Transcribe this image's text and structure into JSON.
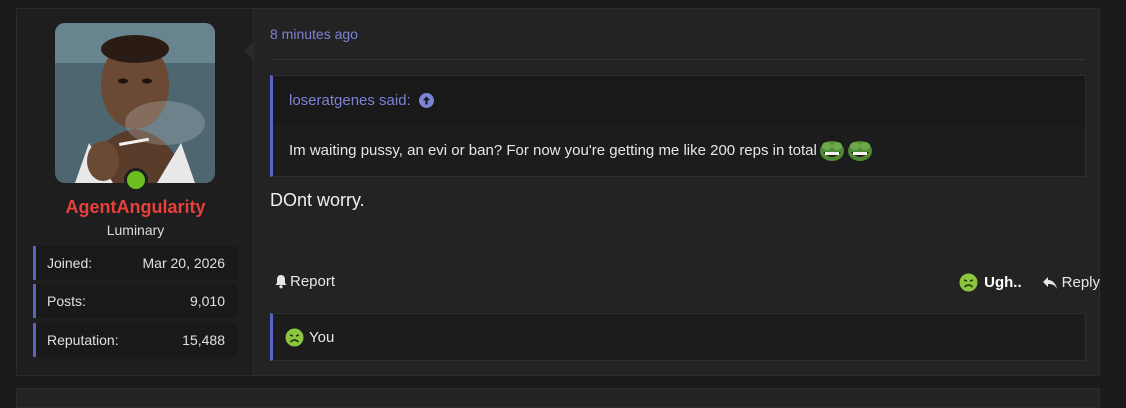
{
  "user": {
    "username": "AgentAngularity",
    "title": "Luminary",
    "online": true,
    "stats": [
      {
        "label": "Joined:",
        "value": "Mar 20, 2026"
      },
      {
        "label": "Posts:",
        "value": "9,010"
      },
      {
        "label": "Reputation:",
        "value": "15,488"
      }
    ]
  },
  "post": {
    "timestamp": "8 minutes ago",
    "quote": {
      "author_said": "loseratgenes said:",
      "text": "Im waiting pussy, an evi or ban? For now you're getting me like 200 reps in total"
    },
    "message": "DOnt worry.",
    "actions": {
      "report_label": "Report",
      "reaction_label": "Ugh..",
      "reply_label": "Reply"
    },
    "reactions_summary": "You"
  },
  "colors": {
    "accent": "#5b63c9",
    "link": "#7c82d6",
    "username": "#e8413b",
    "online": "#6cbf1e",
    "sick_emoji": "#8cc63f"
  },
  "icons": {
    "bell": "bell-icon",
    "reply": "reply-icon",
    "sick_face": "sick-face-icon",
    "up_arrow": "arrow-up-circle-icon",
    "pepe": "pepe-laugh-icon"
  }
}
